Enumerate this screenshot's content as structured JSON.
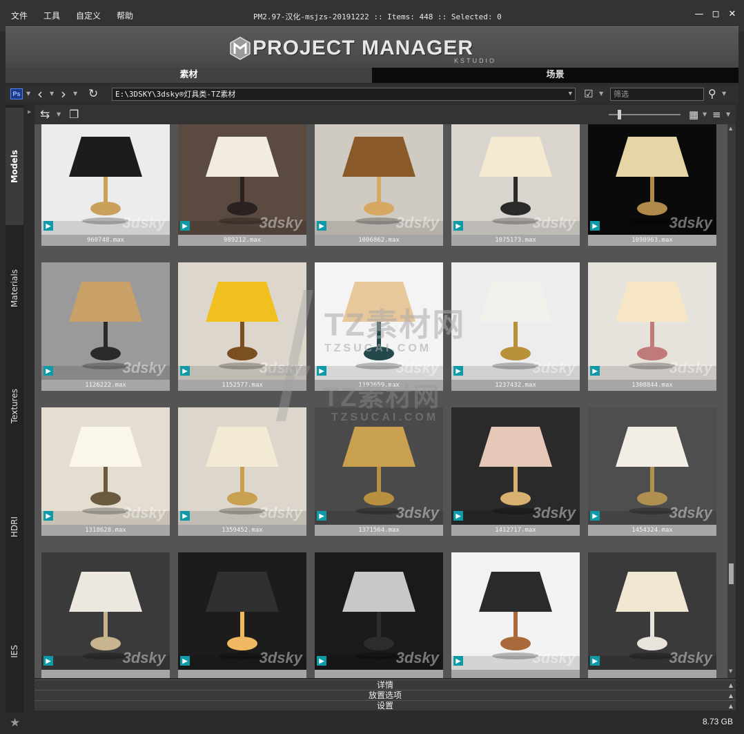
{
  "menu": [
    "文件",
    "工具",
    "自定义",
    "帮助"
  ],
  "window": {
    "title": "PM2.97-汉化-msjzs-20191222  :: Items: 448  :: Selected: 0",
    "buttons": [
      "minimize-icon",
      "maximize-icon",
      "close-icon"
    ]
  },
  "banner": {
    "title": "PROJECT MANAGER",
    "subtitle": "KSTUDIO"
  },
  "tabs": [
    {
      "label": "素材",
      "active": true
    },
    {
      "label": "场景",
      "active": false
    }
  ],
  "toolbar": {
    "ps_label": "Ps",
    "path": "E:\\3DSKY\\3dsky®灯具类-TZ素材",
    "filter_placeholder": "筛选"
  },
  "sidebar": [
    "Models",
    "Materials",
    "Textures",
    "HDRI",
    "IES"
  ],
  "watermark": {
    "thumb_brand": "3dsky",
    "overlay_brand": "TZ素材网",
    "overlay_domain": "TZSUCAI.COM"
  },
  "items": [
    {
      "file": "960748.max"
    },
    {
      "file": "989212.max"
    },
    {
      "file": "1006862.max"
    },
    {
      "file": "1075173.max"
    },
    {
      "file": "1098963.max"
    },
    {
      "file": "1126222.max"
    },
    {
      "file": "1152577.max"
    },
    {
      "file": "1193659.max"
    },
    {
      "file": "1237432.max"
    },
    {
      "file": "1308844.max"
    },
    {
      "file": "1318628.max"
    },
    {
      "file": "1359452.max"
    },
    {
      "file": "1371564.max"
    },
    {
      "file": "1412717.max"
    },
    {
      "file": "1454324.max"
    },
    {
      "file": ""
    },
    {
      "file": ""
    },
    {
      "file": ""
    },
    {
      "file": ""
    },
    {
      "file": ""
    }
  ],
  "panels": [
    "详情",
    "放置选项",
    "设置"
  ],
  "status": {
    "storage": "8.73 GB"
  },
  "colors": {
    "accent": "#0e9aa7",
    "active_tab": "#414141",
    "inactive_tab": "#0b0b0b"
  }
}
